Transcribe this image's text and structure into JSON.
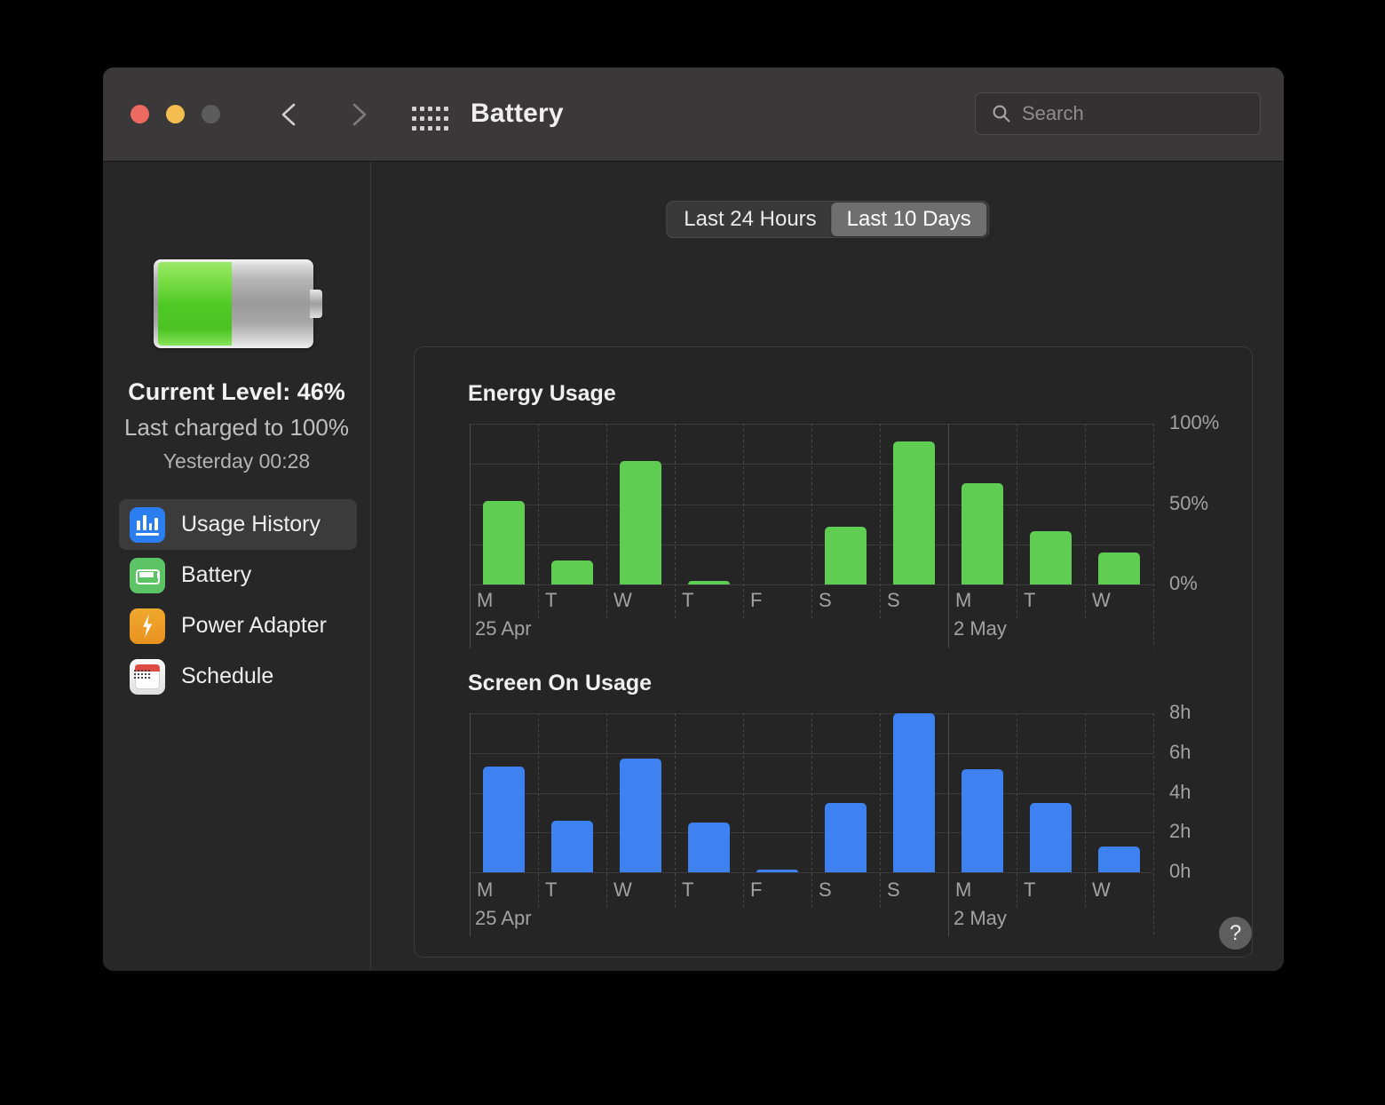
{
  "window": {
    "title": "Battery",
    "traffic_lights": [
      "close-red",
      "minimize-yellow",
      "zoom-disabled"
    ],
    "nav_back_icon": "chevron-left-icon",
    "nav_forward_icon": "chevron-right-icon",
    "grid_icon": "show-all-grid-icon"
  },
  "search": {
    "placeholder": "Search",
    "value": "",
    "icon": "search-icon"
  },
  "sidebar": {
    "battery_icon": "battery-status-icon",
    "battery_fill_percent": 46,
    "current_level": "Current Level: 46%",
    "last_charged": "Last charged to 100%",
    "last_charged_time": "Yesterday 00:28",
    "items": [
      {
        "label": "Usage History",
        "icon": "bar-chart-icon",
        "selected": true
      },
      {
        "label": "Battery",
        "icon": "battery-icon",
        "selected": false
      },
      {
        "label": "Power Adapter",
        "icon": "lightning-bolt-icon",
        "selected": false
      },
      {
        "label": "Schedule",
        "icon": "calendar-icon",
        "selected": false
      }
    ]
  },
  "main": {
    "segmented_control": {
      "options": [
        "Last 24 Hours",
        "Last 10 Days"
      ],
      "selected": "Last 10 Days"
    },
    "help_button": {
      "label": "?",
      "icon": "help-icon"
    }
  },
  "colors": {
    "energy_bar": "#5fcc52",
    "screen_bar": "#3d82f0",
    "accent_selected": "#706f70",
    "grid": "#3c3b3c"
  },
  "chart_data": [
    {
      "type": "bar",
      "title": "Energy Usage",
      "categories": [
        "M",
        "T",
        "W",
        "T",
        "F",
        "S",
        "S",
        "M",
        "T",
        "W"
      ],
      "values": [
        52,
        15,
        77,
        2,
        0,
        36,
        89,
        63,
        33,
        20
      ],
      "xlabel": "",
      "ylabel": "",
      "ylim": [
        0,
        100
      ],
      "ytick_labels": [
        "0%",
        "50%",
        "100%"
      ],
      "ytick_values": [
        0,
        50,
        100
      ],
      "gridline_values": [
        0,
        25,
        50,
        75,
        100
      ],
      "grid": true,
      "week_labels": [
        {
          "text": "25 Apr",
          "index": 0
        },
        {
          "text": "2 May",
          "index": 7
        }
      ],
      "bar_color": "#5fcc52",
      "legend": null
    },
    {
      "type": "bar",
      "title": "Screen On Usage",
      "categories": [
        "M",
        "T",
        "W",
        "T",
        "F",
        "S",
        "S",
        "M",
        "T",
        "W"
      ],
      "values": [
        5.3,
        2.6,
        5.7,
        2.5,
        0.15,
        3.5,
        8.0,
        5.2,
        3.5,
        1.3
      ],
      "xlabel": "",
      "ylabel": "",
      "ylim": [
        0,
        8
      ],
      "ytick_labels": [
        "0h",
        "2h",
        "4h",
        "6h",
        "8h"
      ],
      "ytick_values": [
        0,
        2,
        4,
        6,
        8
      ],
      "gridline_values": [
        0,
        2,
        4,
        6,
        8
      ],
      "grid": true,
      "week_labels": [
        {
          "text": "25 Apr",
          "index": 0
        },
        {
          "text": "2 May",
          "index": 7
        }
      ],
      "bar_color": "#3d82f0",
      "legend": null
    }
  ]
}
